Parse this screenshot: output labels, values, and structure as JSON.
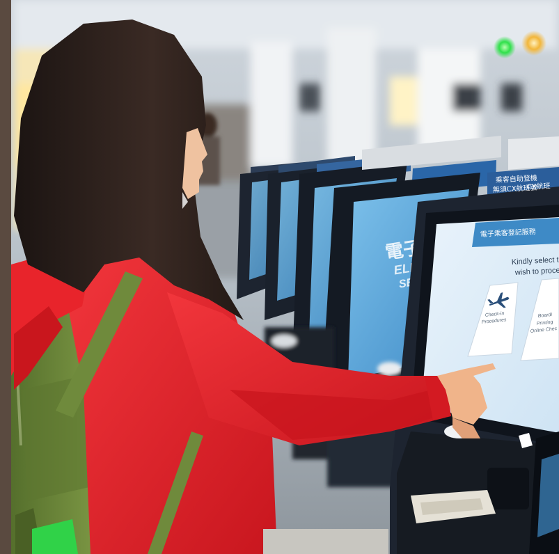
{
  "kiosk_screen": {
    "header_cn": "電子乘客登記服務",
    "prompt_line1": "Kindly select the",
    "prompt_line2": "wish to procee",
    "option_checkin_line1": "Check-in",
    "option_checkin_line2": "Procedures",
    "option_boarding_line1": "Boardi",
    "option_boarding_line2": "Printing",
    "option_boarding_line3": "Online Chec"
  },
  "kiosk_sign": {
    "line1": "乘客自助登機",
    "line2": "無須CX航班號",
    "line3": "CX航班"
  },
  "neighbor_screen": {
    "line1": "電子乘客登",
    "line2": "ELECTRONIC",
    "line3": "SELF CHE"
  },
  "colors": {
    "jacket": "#e8242b",
    "backpack": "#6f8a3c",
    "kiosk_body": "#1d2430",
    "screen_blue": "#5fa8dc",
    "status_light_green": "#2fe04a",
    "status_light_amber": "#f2b63a"
  }
}
